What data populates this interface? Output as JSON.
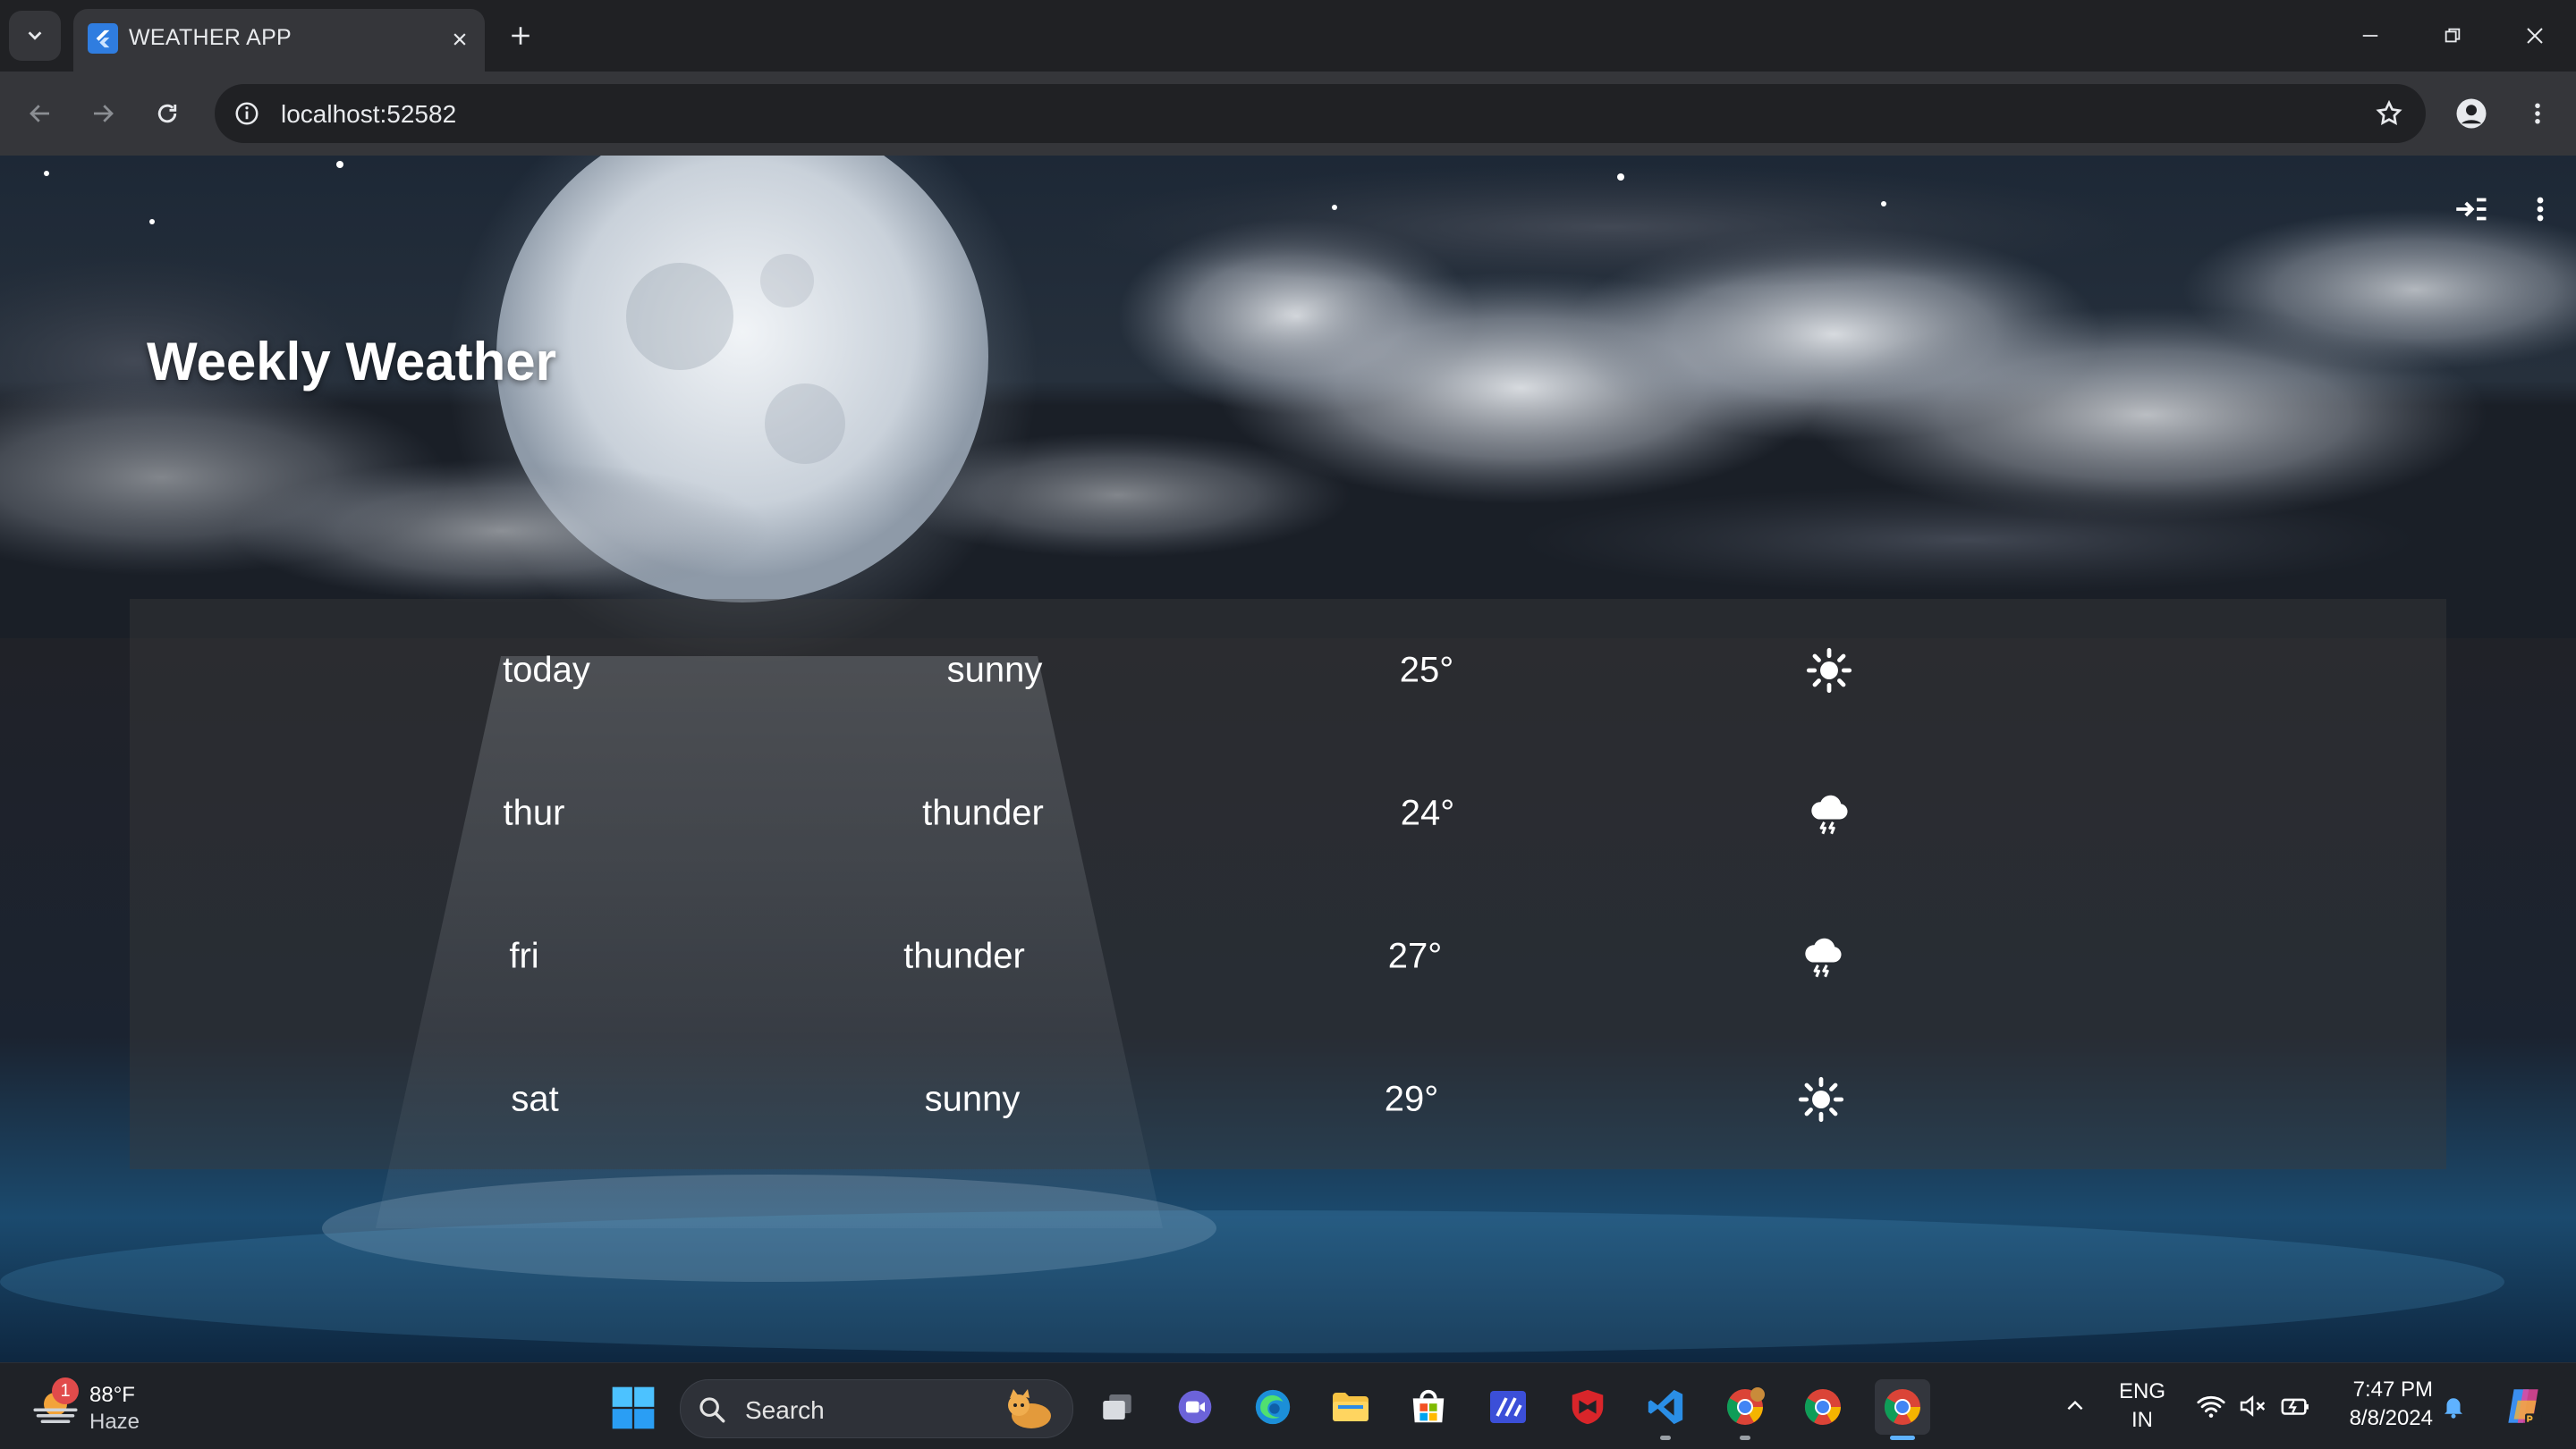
{
  "browser": {
    "tab": {
      "title": "WEATHER APP"
    },
    "omnibox": {
      "url": "localhost:52582"
    }
  },
  "app": {
    "title": "Weekly Weather",
    "forecast": [
      {
        "day": "today",
        "condition": "sunny",
        "temperature": "25°",
        "icon": "sun-icon"
      },
      {
        "day": "thur",
        "condition": "thunder",
        "temperature": "24°",
        "icon": "thunder-cloud-icon"
      },
      {
        "day": "fri",
        "condition": "thunder",
        "temperature": "27°",
        "icon": "thunder-cloud-icon"
      },
      {
        "day": "sat",
        "condition": "sunny",
        "temperature": "29°",
        "icon": "sun-icon"
      }
    ]
  },
  "taskbar": {
    "weather": {
      "badge": "1",
      "temperature": "88°F",
      "condition": "Haze"
    },
    "search": {
      "label": "Search"
    },
    "language": {
      "line1": "ENG",
      "line2": "IN"
    },
    "clock": {
      "time": "7:47 PM",
      "date": "8/8/2024"
    }
  },
  "colors": {
    "accent": "#5fb2ff",
    "chrome_bg": "#202124",
    "toolbar_bg": "#35363a"
  }
}
